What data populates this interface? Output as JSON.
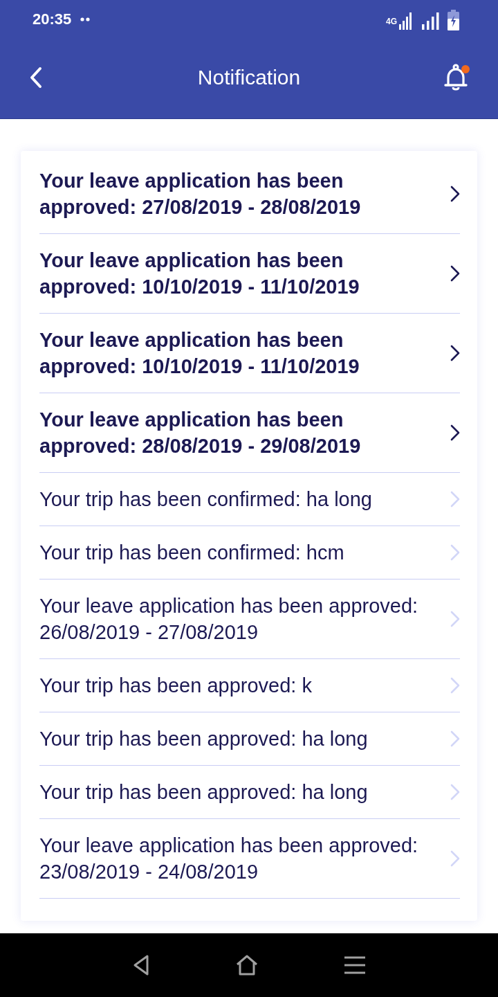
{
  "status_bar": {
    "time": "20:35",
    "network": "4G"
  },
  "app_bar": {
    "title": "Notification",
    "bell_badge": true
  },
  "notifications": [
    {
      "text": "Your leave application has been approved: 27/08/2019 - 28/08/2019",
      "unread": true
    },
    {
      "text": "Your leave application has been approved: 10/10/2019 - 11/10/2019",
      "unread": true
    },
    {
      "text": "Your leave application has been approved: 10/10/2019 - 11/10/2019",
      "unread": true
    },
    {
      "text": "Your leave application has been approved: 28/08/2019 - 29/08/2019",
      "unread": true
    },
    {
      "text": "Your trip has been confirmed: ha long",
      "unread": false
    },
    {
      "text": "Your trip has been confirmed: hcm",
      "unread": false
    },
    {
      "text": "Your leave application has been approved: 26/08/2019 - 27/08/2019",
      "unread": false
    },
    {
      "text": "Your trip has been approved: k",
      "unread": false
    },
    {
      "text": "Your trip has been approved: ha long",
      "unread": false
    },
    {
      "text": "Your trip has been approved: ha long",
      "unread": false
    },
    {
      "text": "Your leave application has been approved: 23/08/2019 - 24/08/2019",
      "unread": false
    }
  ]
}
